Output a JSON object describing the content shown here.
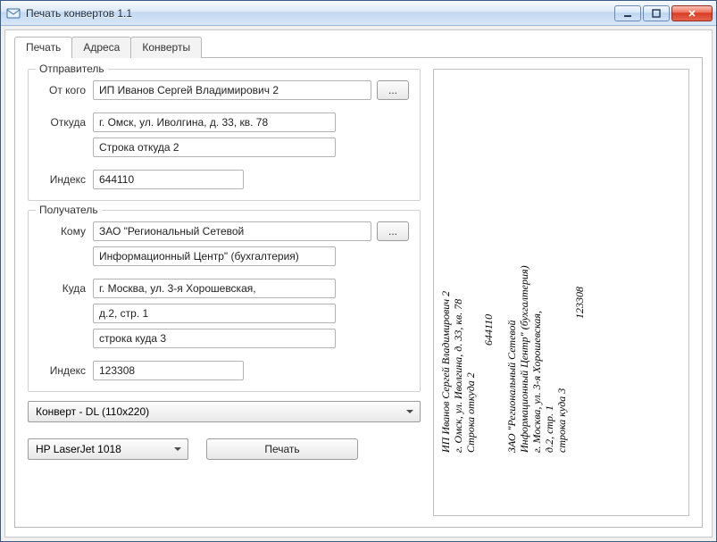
{
  "window": {
    "title": "Печать конвертов 1.1"
  },
  "tabs": {
    "print": "Печать",
    "addresses": "Адреса",
    "envelopes": "Конверты"
  },
  "sender": {
    "legend": "Отправитель",
    "from_label": "От кого",
    "from_value": "ИП Иванов Сергей Владимирович 2",
    "where_label": "Откуда",
    "addr1": "г. Омск, ул. Иволгина, д. 33, кв. 78",
    "addr2": "Строка откуда 2",
    "index_label": "Индекс",
    "index": "644110",
    "pick_btn": "..."
  },
  "recipient": {
    "legend": "Получатель",
    "to_label": "Кому",
    "to1": "ЗАО \"Региональный Сетевой",
    "to2": "Информационный Центр\" (бухгалтерия)",
    "where_label": "Куда",
    "addr1": "г. Москва, ул. 3-я Хорошевская,",
    "addr2": "д.2, стр. 1",
    "addr3": "строка куда 3",
    "index_label": "Индекс",
    "index": "123308",
    "pick_btn": "..."
  },
  "envelope": {
    "selected": "Конверт - DL (110x220)"
  },
  "printer": {
    "selected": "HP LaserJet 1018"
  },
  "buttons": {
    "print": "Печать"
  },
  "preview": {
    "sender_lines": [
      "ИП Иванов Сергей Владимирович 2",
      "г. Омск, ул. Иволгина, д. 33, кв. 78",
      "Строка откуда 2"
    ],
    "sender_index": "644110",
    "recipient_lines": [
      "ЗАО \"Региональный Сетевой",
      "Информационный Центр\" (бухгалтерия)",
      "г. Москва, ул. 3-я Хорошевская,",
      "д.2, стр. 1",
      "строка куда 3"
    ],
    "recipient_index": "123308"
  }
}
